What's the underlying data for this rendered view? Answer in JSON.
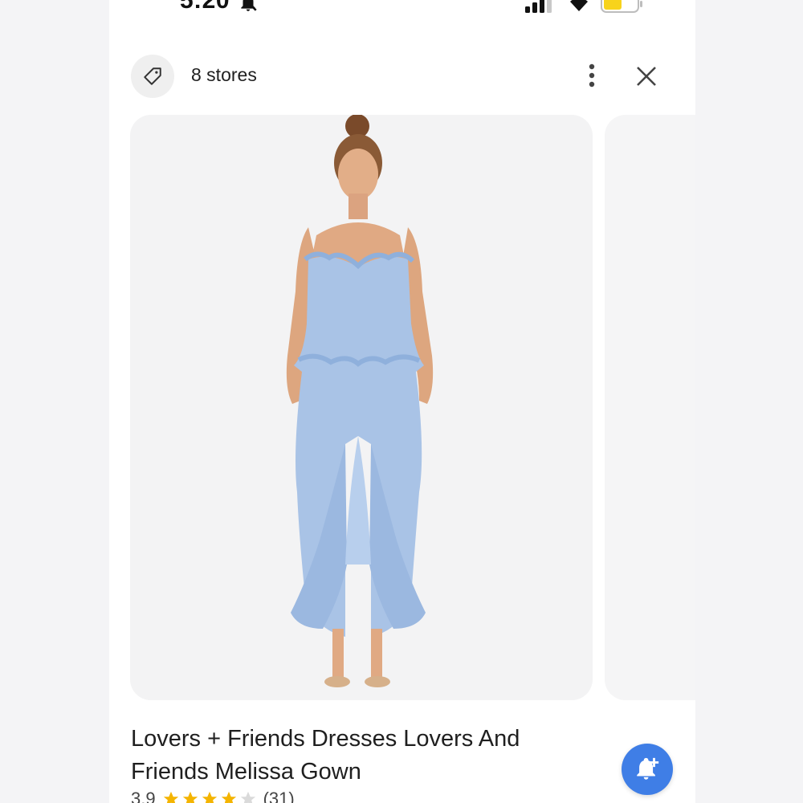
{
  "status_bar": {
    "time": "5:20",
    "icons": [
      "bell-off-icon",
      "signal-icon",
      "wifi-icon",
      "battery-icon"
    ],
    "battery_color": "#f7d31c"
  },
  "header": {
    "stores_label": "8 stores",
    "tag_icon": "price-tag-icon",
    "more_icon": "more-vert-icon",
    "close_icon": "close-icon"
  },
  "product": {
    "title": "Lovers + Friends Dresses Lovers And Friends Melissa Gown",
    "rating": "3.9",
    "stars_filled": 4,
    "stars_total": 5,
    "review_count": "(31)",
    "dress_color": "#a9c3e6"
  },
  "fab": {
    "icon": "add-alert-icon",
    "color": "#3f7ee6"
  }
}
